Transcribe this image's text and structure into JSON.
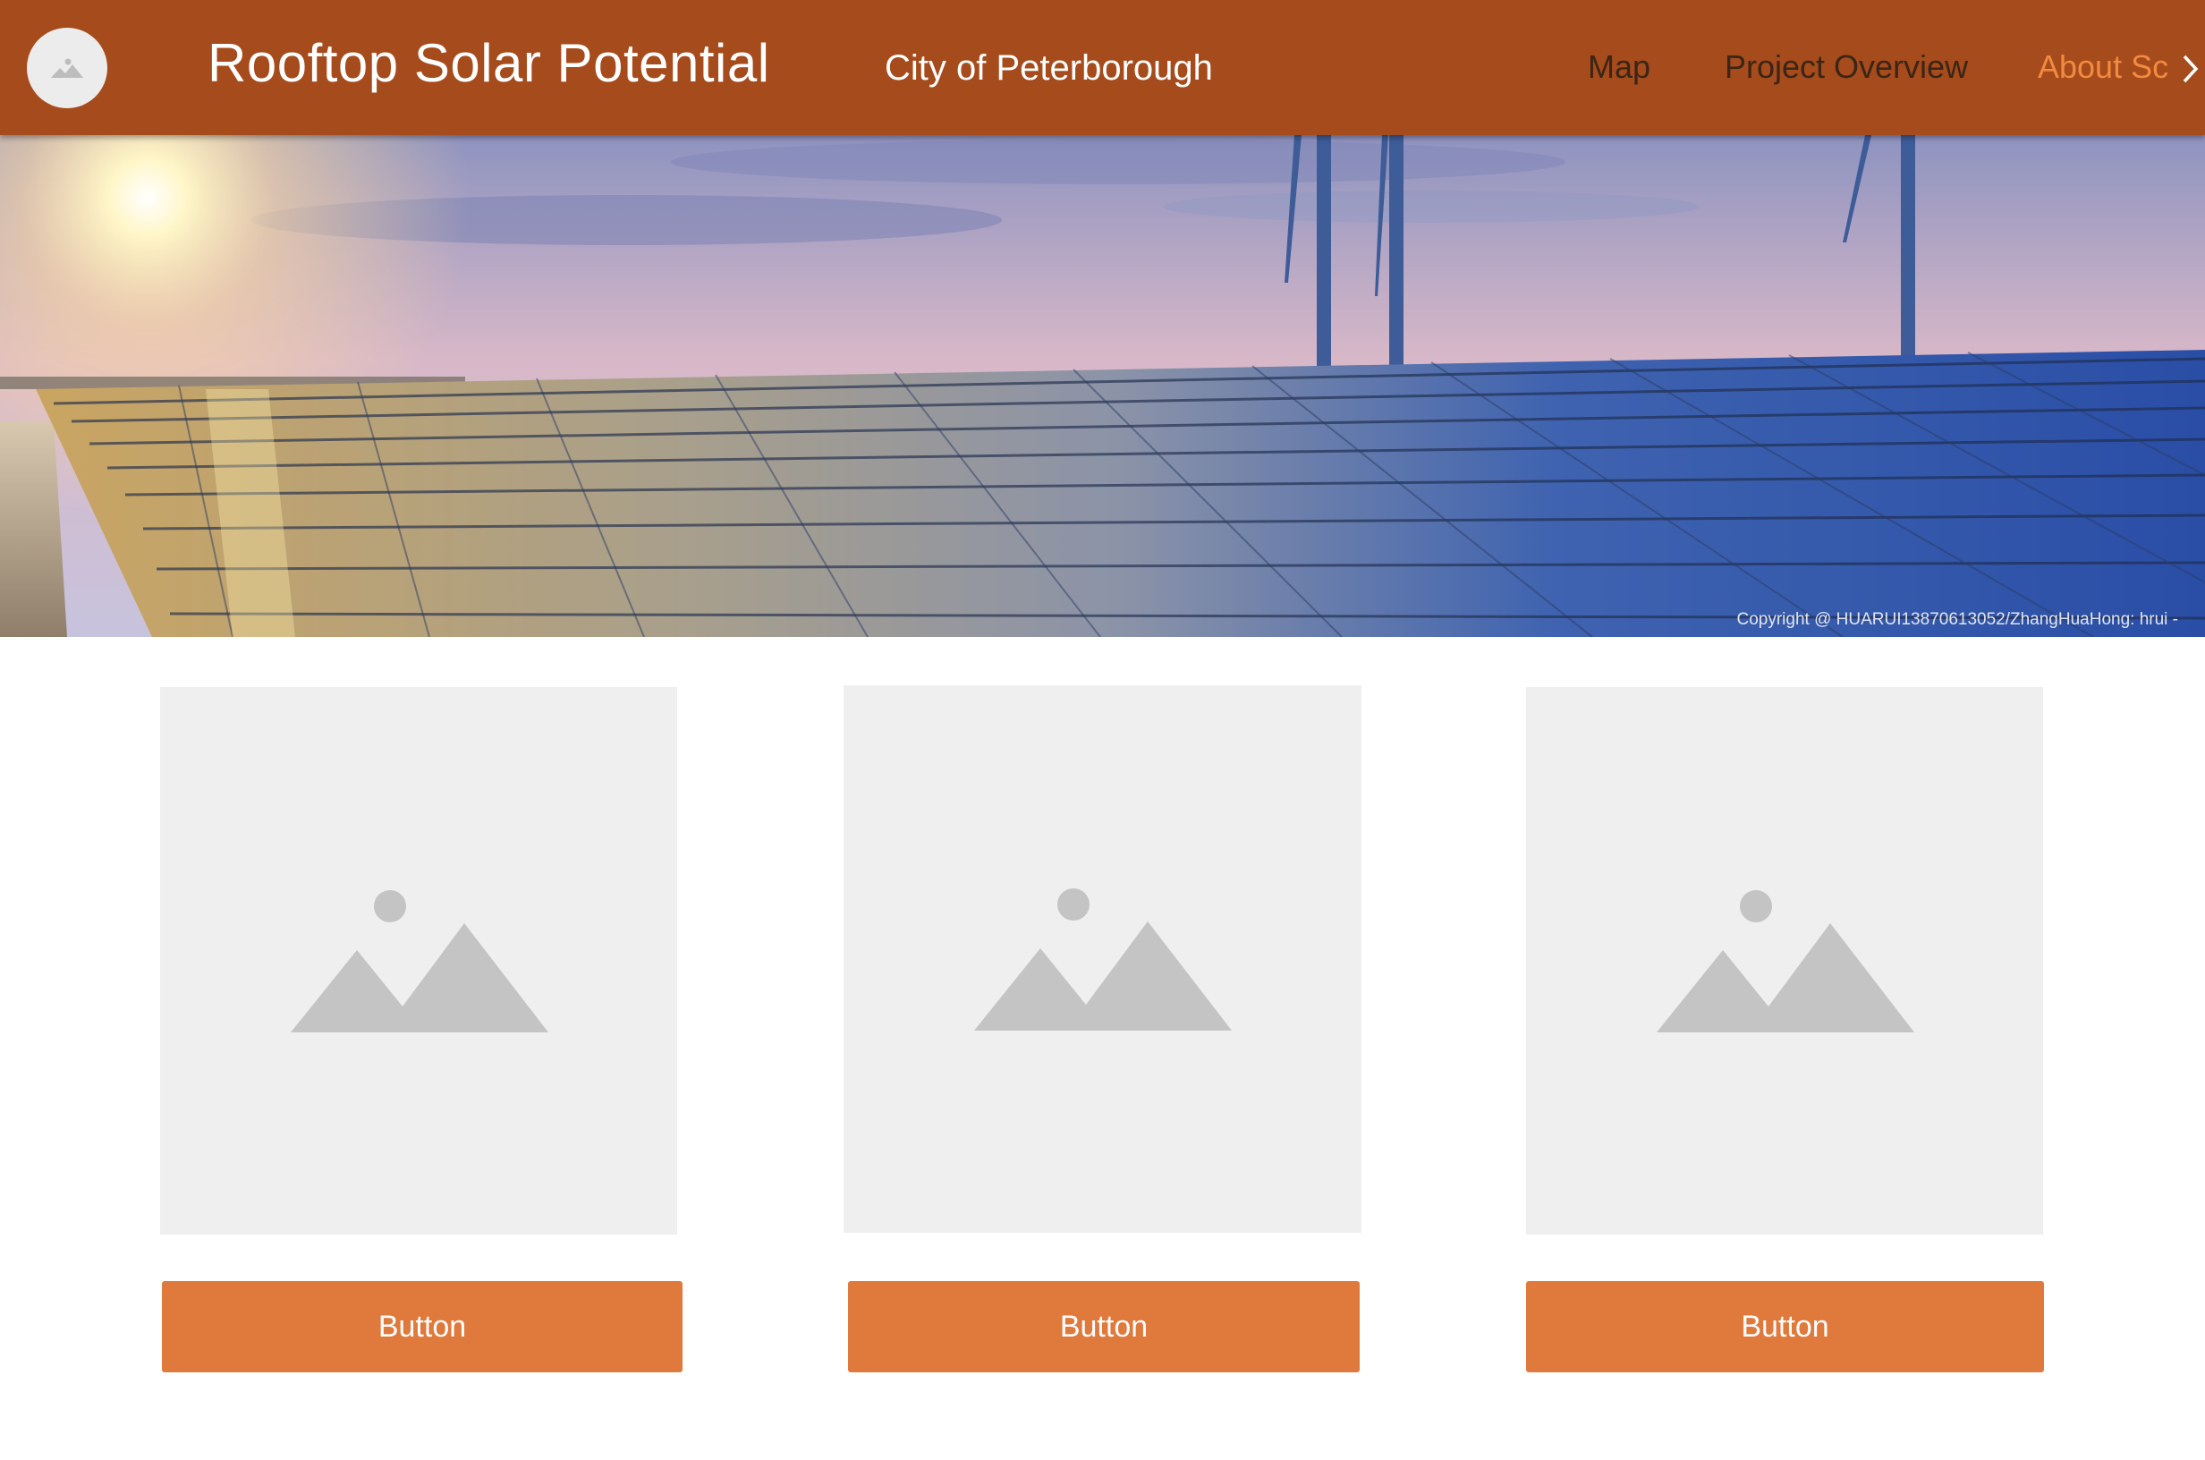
{
  "header": {
    "title": "Rooftop Solar Potential",
    "subtitle": "City of Peterborough",
    "nav": [
      "Map",
      "Project Overview",
      "About Sc"
    ],
    "logo_icon": "image-placeholder-icon",
    "next_icon": "chevron-right-icon",
    "colors": {
      "background": "#a64b1c",
      "active_nav": "#f28a3f",
      "nav": "#3a2516"
    }
  },
  "hero": {
    "credit": "Copyright @ HUARUI13870613052/ZhangHuaHong: hrui -"
  },
  "cards": [
    {
      "image_icon": "image-placeholder-icon",
      "button_label": "Button"
    },
    {
      "image_icon": "image-placeholder-icon",
      "button_label": "Button"
    },
    {
      "image_icon": "image-placeholder-icon",
      "button_label": "Button"
    }
  ],
  "colors": {
    "button": "#e0793c",
    "placeholder_bg": "#efefef",
    "placeholder_icon": "#c4c4c4"
  }
}
